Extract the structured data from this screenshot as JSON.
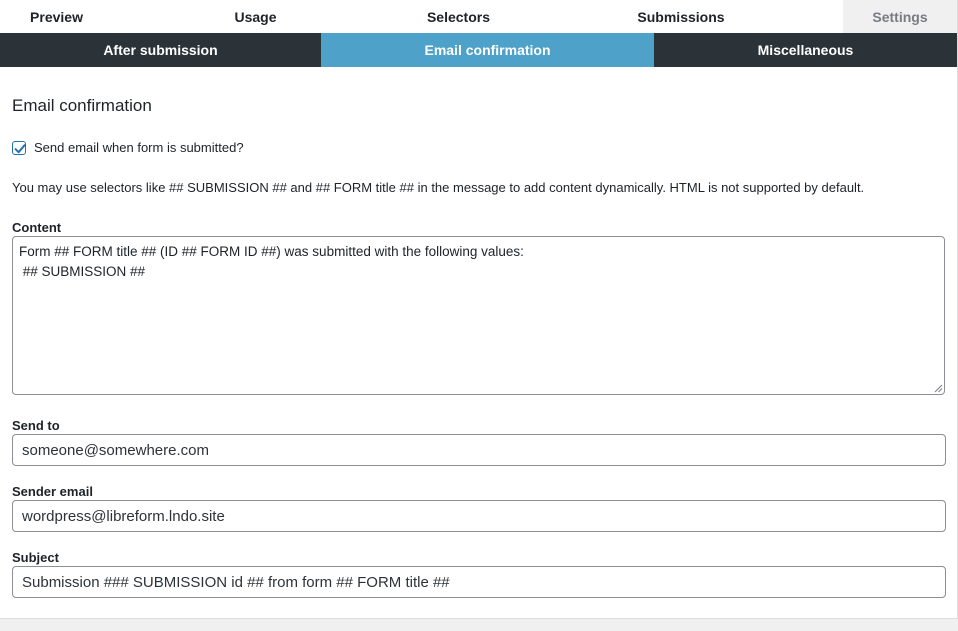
{
  "top_tabs": [
    {
      "label": "Preview"
    },
    {
      "label": "Usage"
    },
    {
      "label": "Selectors"
    },
    {
      "label": "Submissions"
    },
    {
      "label": "Settings"
    }
  ],
  "sub_tabs": [
    {
      "label": "After submission"
    },
    {
      "label": "Email confirmation",
      "active": true
    },
    {
      "label": "Miscellaneous"
    }
  ],
  "section": {
    "title": "Email confirmation",
    "send_email_checkbox": {
      "label": "Send email when form is submitted?",
      "checked": true
    },
    "note": "You may use selectors like ## SUBMISSION ## and ## FORM title ## in the message to add content dynamically. HTML is not supported by default."
  },
  "content_field": {
    "label": "Content",
    "lines": [
      "Form ## FORM title ## (ID ## FORM ID ##) was submitted with the following values:",
      "",
      " ## SUBMISSION ##"
    ]
  },
  "send_to_field": {
    "label": "Send to",
    "value": "someone@somewhere.com"
  },
  "sender_email_field": {
    "label": "Sender email",
    "value": "wordpress@libreform.lndo.site"
  },
  "subject_field": {
    "label": "Subject",
    "value": "Submission ### SUBMISSION id ## from form ## FORM title ##"
  },
  "colors": {
    "active_subtab": "#4ea1c9",
    "dark_bar": "#2c3338",
    "checkbox_accent": "#2271b1"
  }
}
